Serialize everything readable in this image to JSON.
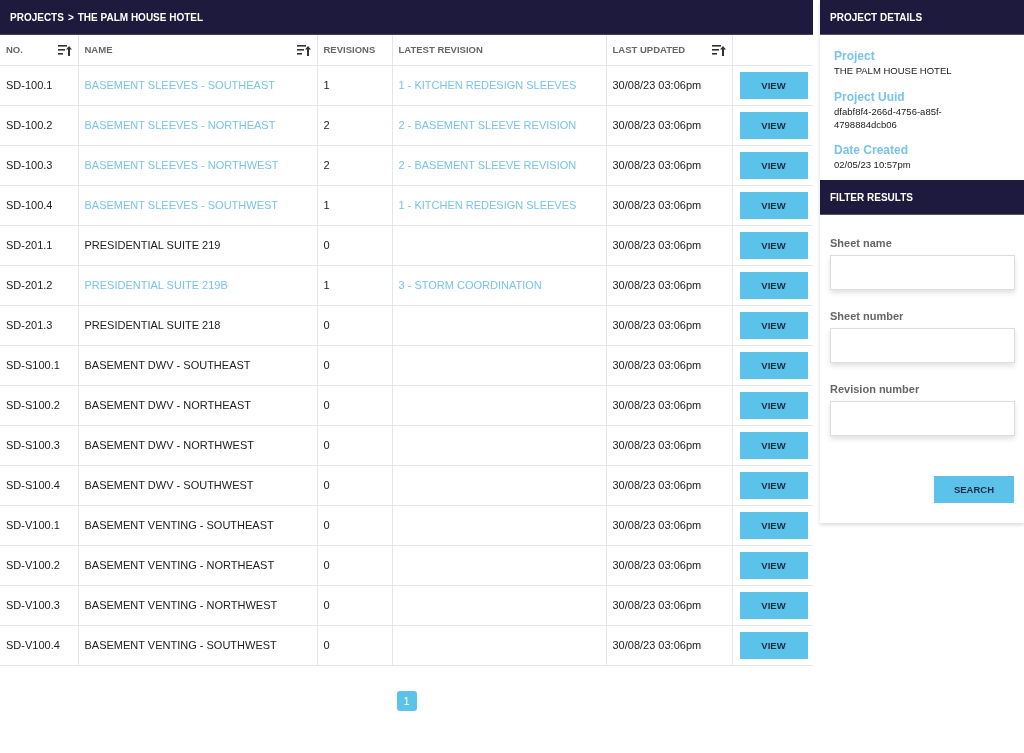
{
  "breadcrumb": {
    "parent": "PROJECTS",
    "separator": ">",
    "current": "THE PALM HOUSE HOTEL"
  },
  "table": {
    "columns": [
      {
        "label": "NO.",
        "sortable": true
      },
      {
        "label": "NAME",
        "sortable": true
      },
      {
        "label": "REVISIONS",
        "sortable": false
      },
      {
        "label": "LATEST REVISION",
        "sortable": false
      },
      {
        "label": "LAST UPDATED",
        "sortable": true
      }
    ],
    "rows": [
      {
        "no": "SD-100.1",
        "name": "BASEMENT SLEEVES - SOUTHEAST",
        "linked": true,
        "revisions": "1",
        "latest_revision": "1 - KITCHEN REDESIGN SLEEVES",
        "last_updated": "30/08/23 03:06pm",
        "action": "VIEW"
      },
      {
        "no": "SD-100.2",
        "name": "BASEMENT SLEEVES - NORTHEAST",
        "linked": true,
        "revisions": "2",
        "latest_revision": "2 - BASEMENT SLEEVE REVISION",
        "last_updated": "30/08/23 03:06pm",
        "action": "VIEW"
      },
      {
        "no": "SD-100.3",
        "name": "BASEMENT SLEEVES - NORTHWEST",
        "linked": true,
        "revisions": "2",
        "latest_revision": "2 - BASEMENT SLEEVE REVISION",
        "last_updated": "30/08/23 03:06pm",
        "action": "VIEW"
      },
      {
        "no": "SD-100.4",
        "name": "BASEMENT SLEEVES - SOUTHWEST",
        "linked": true,
        "revisions": "1",
        "latest_revision": "1 - KITCHEN REDESIGN SLEEVES",
        "last_updated": "30/08/23 03:06pm",
        "action": "VIEW"
      },
      {
        "no": "SD-201.1",
        "name": "PRESIDENTIAL SUITE 219",
        "linked": false,
        "revisions": "0",
        "last_updated": "30/08/23 03:06pm",
        "action": "VIEW"
      },
      {
        "no": "SD-201.2",
        "name": "PRESIDENTIAL SUITE 219B",
        "linked": true,
        "revisions": "1",
        "latest_revision": "3 - STORM COORDINATION",
        "last_updated": "30/08/23 03:06pm",
        "action": "VIEW"
      },
      {
        "no": "SD-201.3",
        "name": "PRESIDENTIAL SUITE 218",
        "linked": false,
        "revisions": "0",
        "last_updated": "30/08/23 03:06pm",
        "action": "VIEW"
      },
      {
        "no": "SD-S100.1",
        "name": "BASEMENT DWV - SOUTHEAST",
        "linked": false,
        "revisions": "0",
        "last_updated": "30/08/23 03:06pm",
        "action": "VIEW"
      },
      {
        "no": "SD-S100.2",
        "name": "BASEMENT DWV - NORTHEAST",
        "linked": false,
        "revisions": "0",
        "last_updated": "30/08/23 03:06pm",
        "action": "VIEW"
      },
      {
        "no": "SD-S100.3",
        "name": "BASEMENT DWV - NORTHWEST",
        "linked": false,
        "revisions": "0",
        "last_updated": "30/08/23 03:06pm",
        "action": "VIEW"
      },
      {
        "no": "SD-S100.4",
        "name": "BASEMENT DWV - SOUTHWEST",
        "linked": false,
        "revisions": "0",
        "last_updated": "30/08/23 03:06pm",
        "action": "VIEW"
      },
      {
        "no": "SD-V100.1",
        "name": "BASEMENT VENTING - SOUTHEAST",
        "linked": false,
        "revisions": "0",
        "last_updated": "30/08/23 03:06pm",
        "action": "VIEW"
      },
      {
        "no": "SD-V100.2",
        "name": "BASEMENT VENTING - NORTHEAST",
        "linked": false,
        "revisions": "0",
        "last_updated": "30/08/23 03:06pm",
        "action": "VIEW"
      },
      {
        "no": "SD-V100.3",
        "name": "BASEMENT VENTING - NORTHWEST",
        "linked": false,
        "revisions": "0",
        "last_updated": "30/08/23 03:06pm",
        "action": "VIEW"
      },
      {
        "no": "SD-V100.4",
        "name": "BASEMENT VENTING - SOUTHWEST",
        "linked": false,
        "revisions": "0",
        "last_updated": "30/08/23 03:06pm",
        "action": "VIEW"
      }
    ]
  },
  "pagination": [
    {
      "label": "1",
      "selected": true
    }
  ],
  "project_details": {
    "title": "PROJECT DETAILS",
    "fields": [
      {
        "label": "Project",
        "value": "THE PALM HOUSE HOTEL"
      },
      {
        "label": "Project Uuid",
        "value": "dfabf8f4-266d-4756-a85f-4798884dcb06"
      },
      {
        "label": "Date Created",
        "value": "02/05/23 10:57pm"
      }
    ]
  },
  "filter": {
    "title": "FILTER RESULTS",
    "fields": [
      {
        "label": "Sheet name"
      },
      {
        "label": "Sheet number"
      },
      {
        "label": "Revision number"
      }
    ],
    "button": "SEARCH"
  }
}
